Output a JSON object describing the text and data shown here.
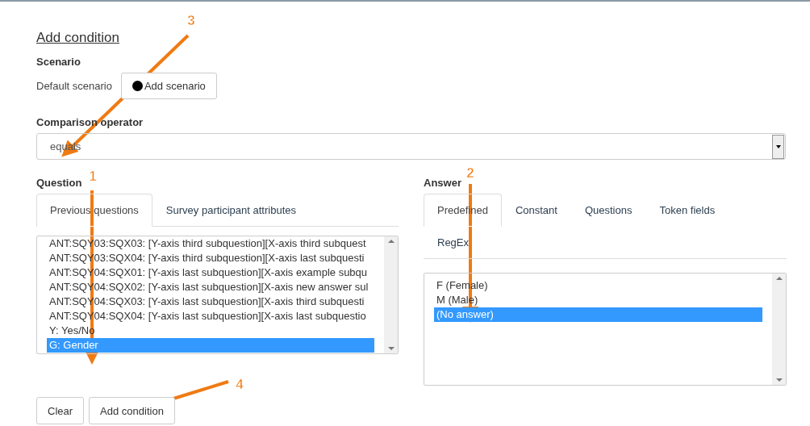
{
  "title": "Add condition",
  "scenario": {
    "label": "Scenario",
    "value": "Default scenario",
    "button": "Add scenario"
  },
  "comparison": {
    "label": "Comparison operator",
    "value": "equals"
  },
  "question": {
    "label": "Question",
    "tabs": [
      {
        "label": "Previous questions",
        "selected": true
      },
      {
        "label": "Survey participant attributes",
        "selected": false
      }
    ],
    "items": [
      {
        "label": "ANT:SQY03:SQX03: [Y-axis third subquestion][X-axis third subquest",
        "selected": false
      },
      {
        "label": "ANT:SQY03:SQX04: [Y-axis third subquestion][X-axis last subquesti",
        "selected": false
      },
      {
        "label": "ANT:SQY04:SQX01: [Y-axis last subquestion][X-axis example subqu",
        "selected": false
      },
      {
        "label": "ANT:SQY04:SQX02: [Y-axis last subquestion][X-axis new answer sul",
        "selected": false
      },
      {
        "label": "ANT:SQY04:SQX03: [Y-axis last subquestion][X-axis third subquesti",
        "selected": false
      },
      {
        "label": "ANT:SQY04:SQX04: [Y-axis last subquestion][X-axis last subquestio",
        "selected": false
      },
      {
        "label": "Y: Yes/No",
        "selected": false
      },
      {
        "label": "G: Gender",
        "selected": true
      }
    ]
  },
  "answer": {
    "label": "Answer",
    "tabs": [
      {
        "label": "Predefined",
        "selected": true
      },
      {
        "label": "Constant",
        "selected": false
      },
      {
        "label": "Questions",
        "selected": false
      },
      {
        "label": "Token fields",
        "selected": false
      },
      {
        "label": "RegEx",
        "selected": false
      }
    ],
    "items": [
      {
        "label": "F (Female)",
        "selected": false
      },
      {
        "label": "M (Male)",
        "selected": false
      },
      {
        "label": "(No answer)",
        "selected": true
      }
    ]
  },
  "buttons": [
    "Clear",
    "Add condition"
  ],
  "annotations": [
    {
      "number": "1"
    },
    {
      "number": "2"
    },
    {
      "number": "3"
    },
    {
      "number": "4"
    }
  ]
}
